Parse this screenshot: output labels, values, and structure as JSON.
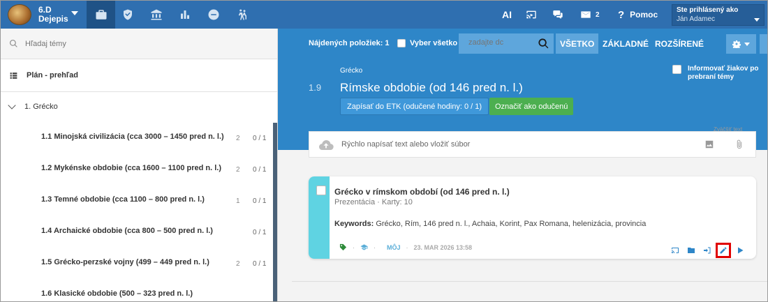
{
  "topbar": {
    "class_name": "6.D",
    "subject": "Dejepis",
    "ai_label": "AI",
    "messages_count": "2",
    "help_label": "Pomoc",
    "user_line1": "Ste prihlásený ako",
    "user_line2": "Ján Adamec",
    "nav_icons": [
      "briefcase-icon",
      "shield-icon",
      "bank-icon",
      "bar-chart-icon",
      "no-entry-icon",
      "people-walking-icon"
    ]
  },
  "sidebar": {
    "search_placeholder": "Hľadaj témy",
    "plan_label": "Plán - prehľad",
    "topic_label": "1. Grécko",
    "lessons": [
      {
        "title": "1.1  Minojská civilizácia (cca 3000 – 1450 pred n. l.)",
        "count": "2",
        "ratio": "0 / 1"
      },
      {
        "title": "1.2  Mykénske obdobie (cca 1600 – 1100 pred n. l.)",
        "count": "2",
        "ratio": "0 / 1"
      },
      {
        "title": "1.3  Temné obdobie (cca 1100 – 800 pred n. l.)",
        "count": "1",
        "ratio": "0 / 1"
      },
      {
        "title": "1.4  Archaické obdobie (cca 800 – 500 pred n. l.)",
        "count": "",
        "ratio": "0 / 1"
      },
      {
        "title": "1.5  Grécko-perzské vojny (499 – 449 pred n. l.)",
        "count": "2",
        "ratio": "0 / 1"
      },
      {
        "title": "1.6  Klasické obdobie (500 – 323 pred n. l.)",
        "count": "",
        "ratio": ""
      }
    ]
  },
  "toolbar": {
    "found_label": "Nájdených položiek: 1",
    "select_all_label": "Vyber všetko",
    "search_placeholder": "zadajte dc",
    "filter_all": "VŠETKO",
    "filter_basic": "ZÁKLADNÉ",
    "filter_extended": "ROZŠÍRENÉ"
  },
  "header": {
    "breadcrumb": "Grécko",
    "number": "1.9",
    "title": "Rímske obdobie (od 146 pred n. l.)",
    "etk_button": "Zapísať do ETK (odučené hodiny: 0 / 1)",
    "done_button": "Označiť ako odučenú",
    "inform_label": "Informovať žiakov po prebraní témy"
  },
  "quick": {
    "zoom_text": "Zväčšiť text",
    "placeholder": "Rýchlo napísať text alebo vložiť súbor"
  },
  "card": {
    "title": "Grécko v rímskom období (od 146 pred n. l.)",
    "subtitle": "Prezentácia · Karty: 10",
    "keywords_label": "Keywords:",
    "keywords": "Grécko, Rím, 146 pred n. l., Achaia, Korint, Pax Romana, helenizácia, provincia",
    "mine_label": "MÔJ",
    "date": "23. MAR 2026 13:58",
    "dot": "·"
  },
  "colors": {
    "topbar": "#2f6fb0",
    "header": "#2e86c8",
    "card_stripe": "#5fd3e2",
    "done_button": "#4caf50",
    "highlight": "#e00000"
  }
}
